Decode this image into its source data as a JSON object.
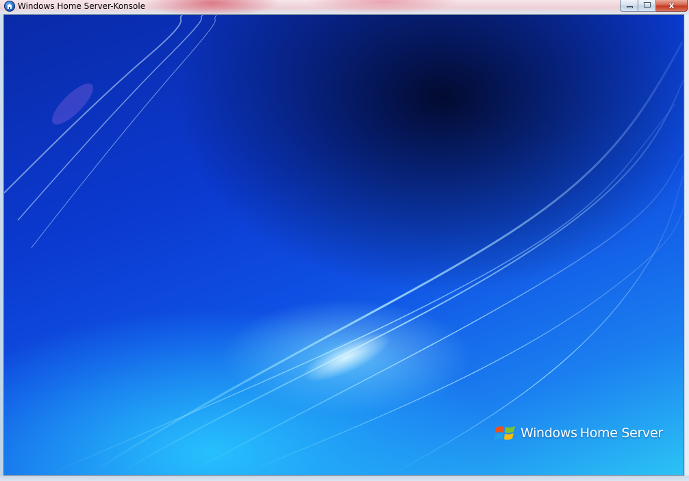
{
  "window": {
    "title": "Windows Home Server-Konsole",
    "app_icon": "home-server-icon",
    "caption_buttons": {
      "minimize": "minimize-icon",
      "maximize": "maximize-icon",
      "close_label": "x"
    }
  },
  "splash": {
    "logo_icon": "windows-flag-icon",
    "product_name": "Windows",
    "product_name_rest": "Home Server"
  },
  "colors": {
    "background_dark": "#020828",
    "background_mid": "#0f4fe3",
    "background_light": "#2bc3f5",
    "close_button": "#c5391f"
  }
}
